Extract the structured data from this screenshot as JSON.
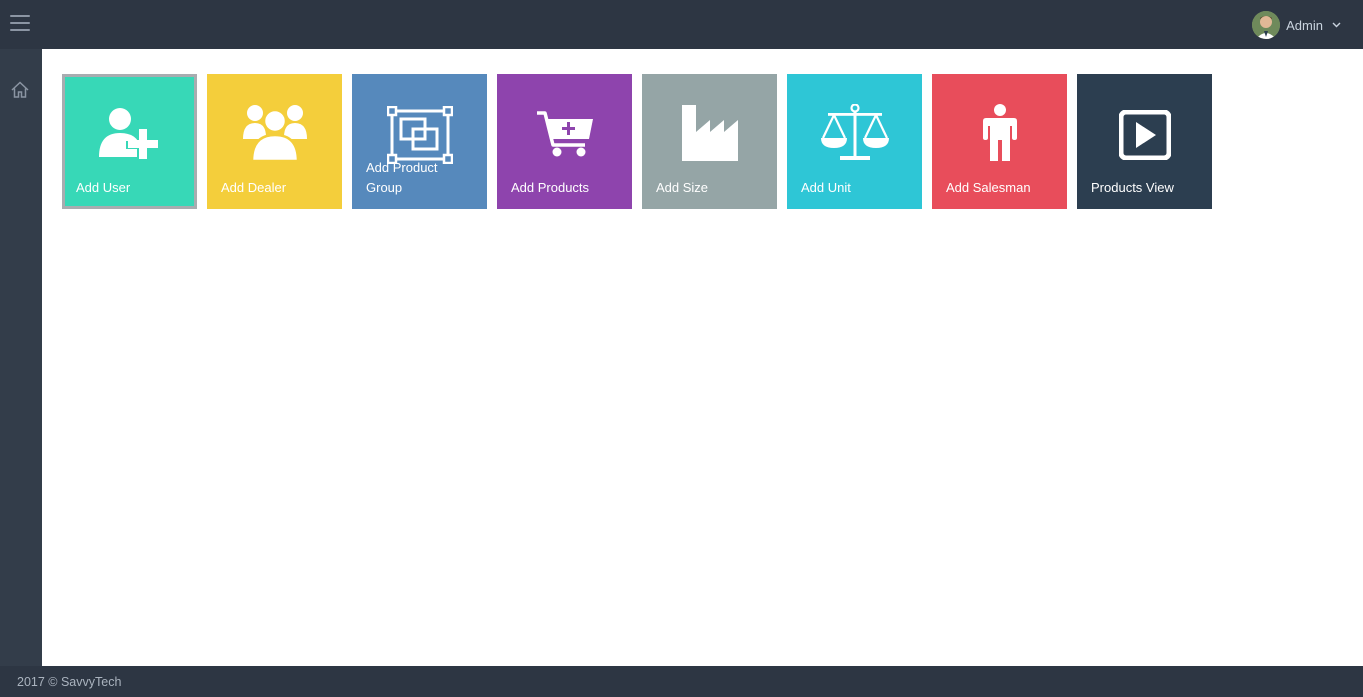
{
  "header": {
    "menu_icon": "hamburger-icon",
    "user": {
      "name": "Admin",
      "avatar_icon": "avatar",
      "dropdown_icon": "chevron-down-icon"
    }
  },
  "sidebar": {
    "items": [
      {
        "icon": "home-icon"
      }
    ]
  },
  "tiles": [
    {
      "label": "Add User",
      "icon": "add-user-icon",
      "color": "#37d8b7",
      "selected": true
    },
    {
      "label": "Add Dealer",
      "icon": "users-group-icon",
      "color": "#f4ce3b"
    },
    {
      "label": "Add Product Group",
      "icon": "product-group-icon",
      "color": "#5689bc"
    },
    {
      "label": "Add Products",
      "icon": "cart-add-icon",
      "color": "#8e44ad"
    },
    {
      "label": "Add Size",
      "icon": "factory-icon",
      "color": "#95a5a6"
    },
    {
      "label": "Add Unit",
      "icon": "scale-icon",
      "color": "#2ec6d6"
    },
    {
      "label": "Add Salesman",
      "icon": "person-icon",
      "color": "#e84d5b"
    },
    {
      "label": "Products View",
      "icon": "play-icon",
      "color": "#2c3e50"
    }
  ],
  "footer": {
    "text": "2017 © SavvyTech"
  }
}
